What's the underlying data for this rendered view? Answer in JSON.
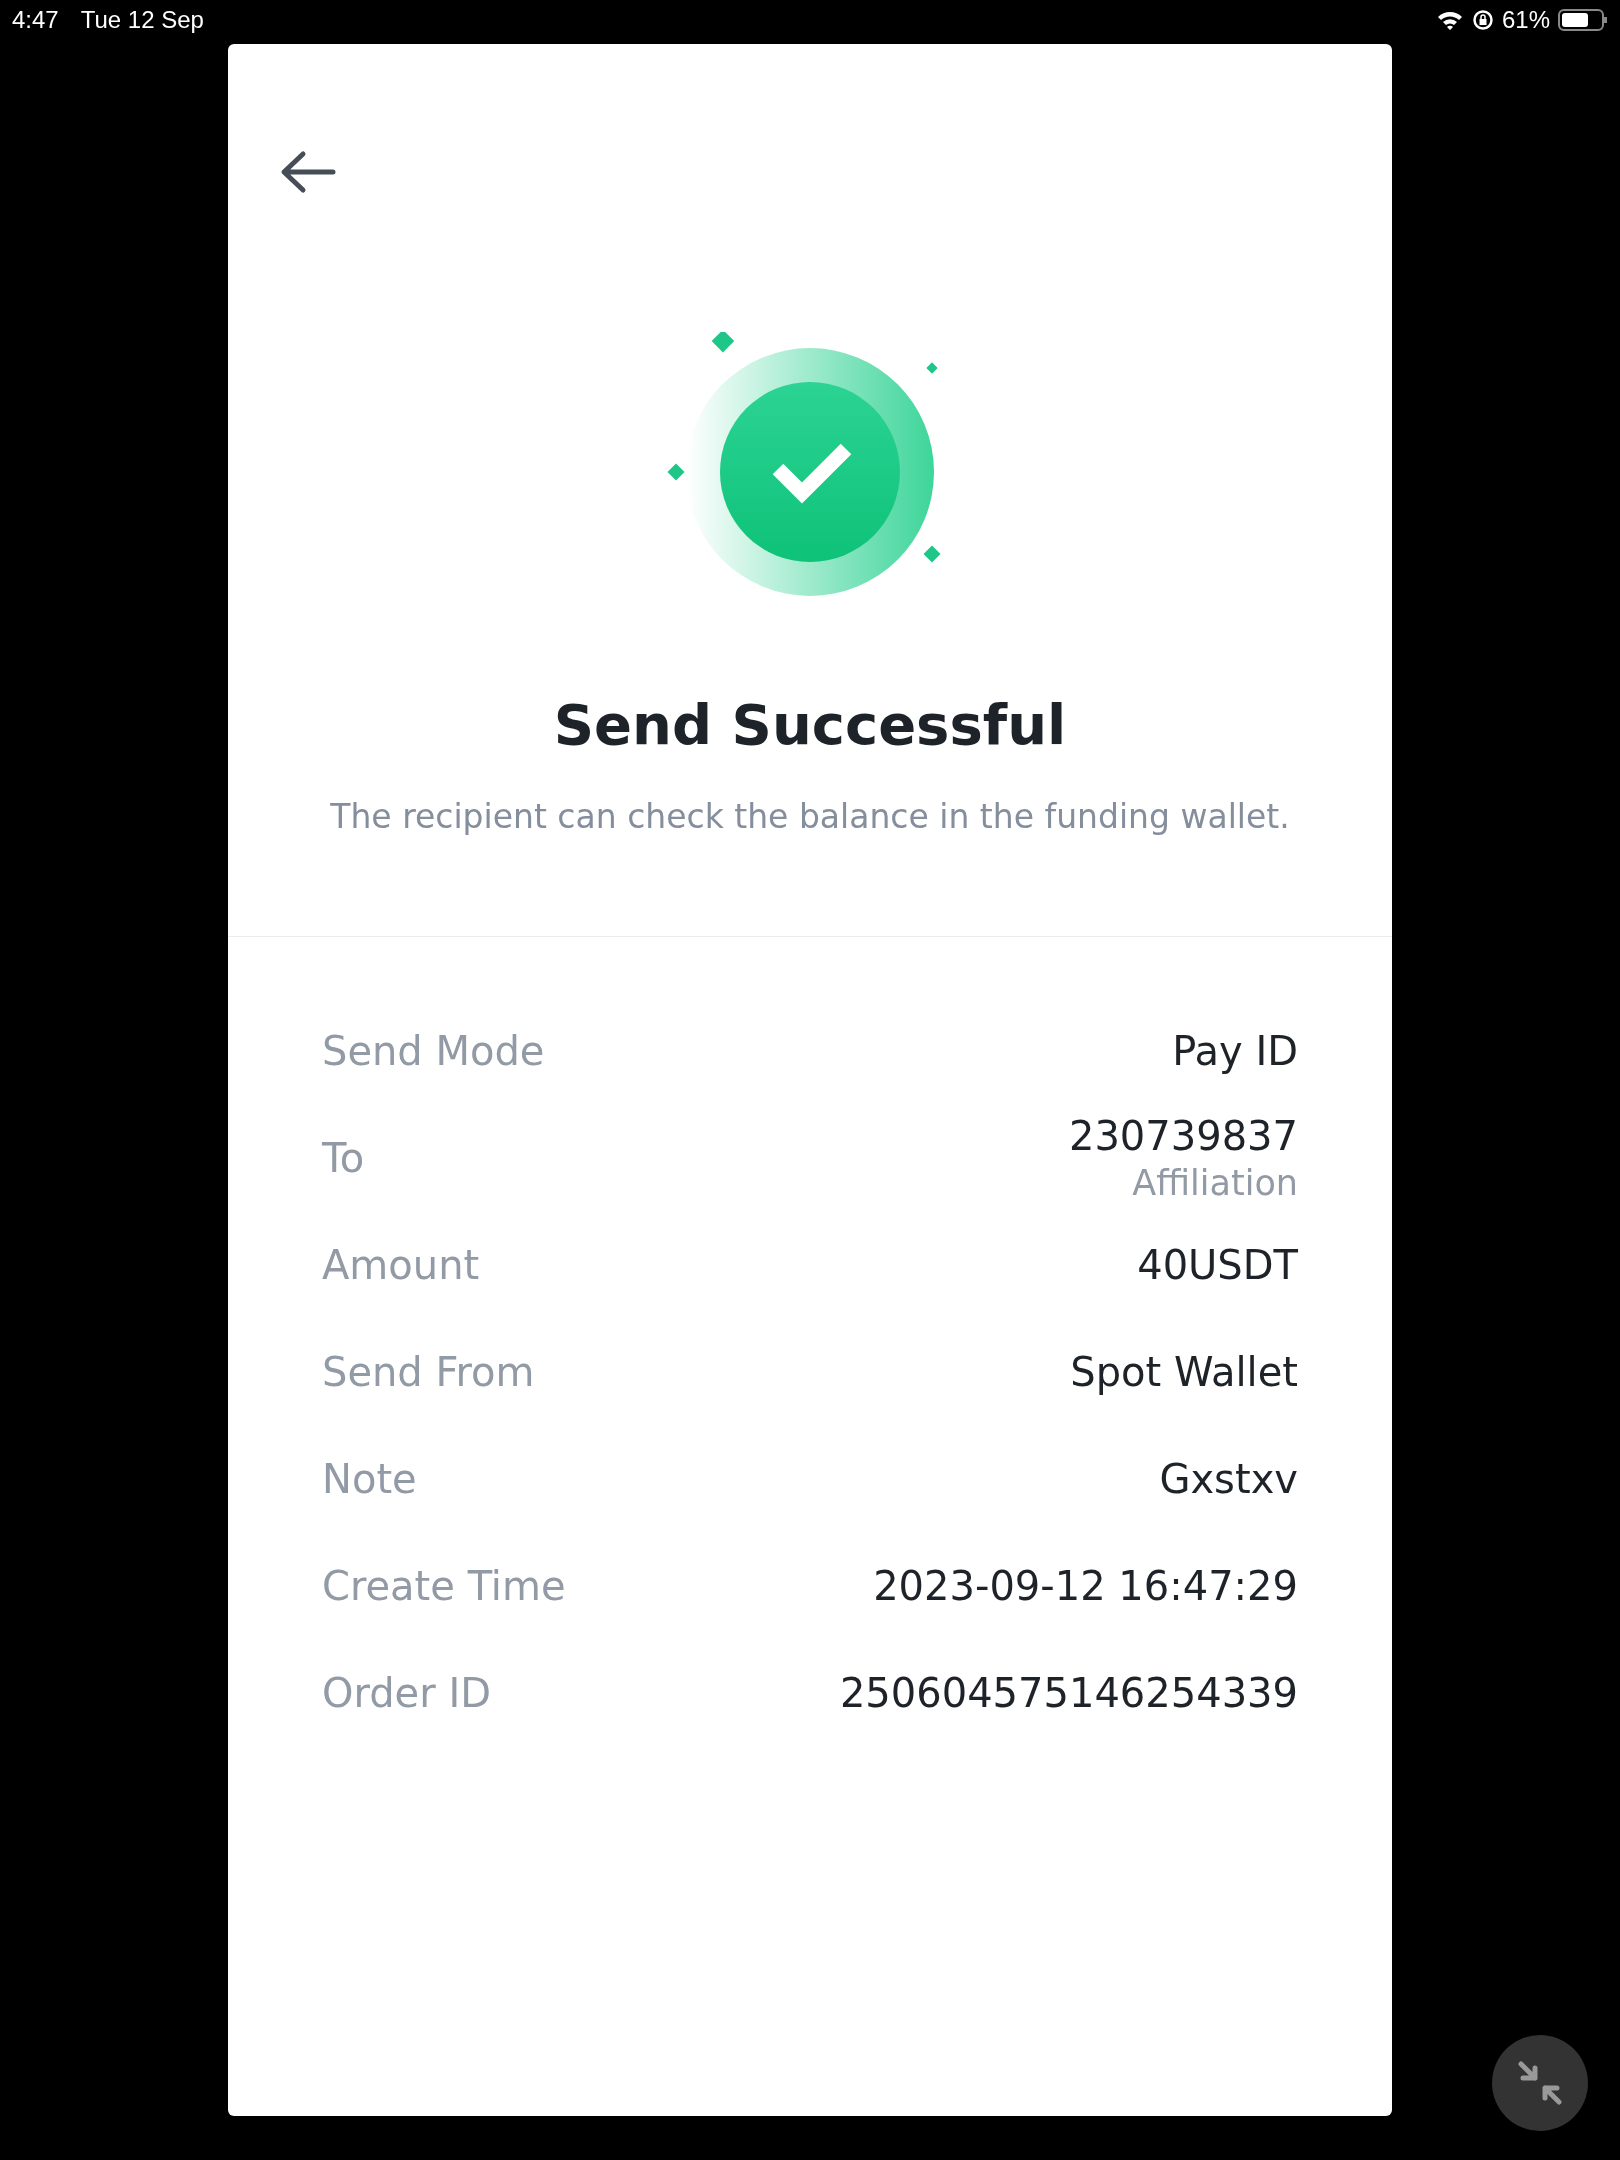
{
  "status_bar": {
    "time": "4:47",
    "date": "Tue 12 Sep",
    "battery": "61%"
  },
  "header": {
    "title": "Send Successful",
    "subtitle": "The recipient can check the balance in the funding wallet."
  },
  "details": [
    {
      "label": "Send Mode",
      "value": "Pay ID"
    },
    {
      "label": "To",
      "value": "230739837",
      "sub": "Affiliation"
    },
    {
      "label": "Amount",
      "value": "40USDT"
    },
    {
      "label": "Send From",
      "value": "Spot Wallet"
    },
    {
      "label": "Note",
      "value": "Gxstxv"
    },
    {
      "label": "Create Time",
      "value": "2023-09-12 16:47:29"
    },
    {
      "label": "Order ID",
      "value": "250604575146254339"
    }
  ]
}
